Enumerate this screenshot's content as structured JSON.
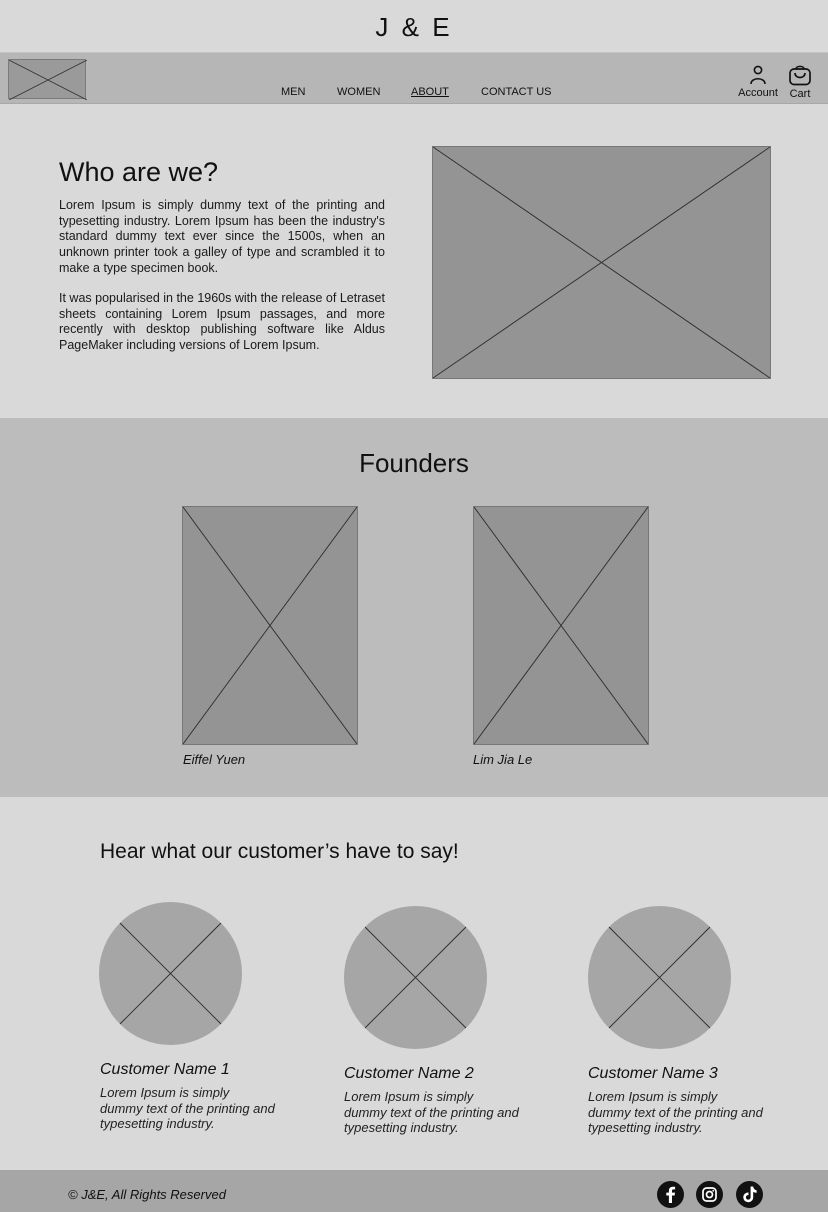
{
  "brand": "J & E",
  "nav": {
    "links": [
      {
        "label": "MEN"
      },
      {
        "label": "WOMEN"
      },
      {
        "label": "ABOUT",
        "active": true
      },
      {
        "label": "CONTACT US"
      }
    ],
    "account_label": "Account",
    "cart_label": "Cart",
    "account_icon": "user-icon",
    "cart_icon": "shopping-bag-icon"
  },
  "about": {
    "title": "Who are we?",
    "paragraph1": "Lorem Ipsum is simply dummy text of the printing and typesetting industry. Lorem Ipsum has been the industry's standard dummy text ever since the 1500s, when an unknown printer took a galley of type and scrambled it to make a type specimen book.",
    "paragraph2": "It was popularised in the 1960s with the release of Letraset sheets containing Lorem Ipsum passages, and more recently with desktop publishing software like Aldus PageMaker including versions of Lorem Ipsum."
  },
  "founders": {
    "title": "Founders",
    "people": [
      {
        "name": "Eiffel Yuen"
      },
      {
        "name": "Lim Jia Le"
      }
    ]
  },
  "testimonials": {
    "title": "Hear what our customer’s have to say!",
    "items": [
      {
        "name": "Customer Name 1",
        "text": "Lorem Ipsum is simply dummy text of the printing and typesetting industry."
      },
      {
        "name": "Customer Name 2",
        "text": "Lorem Ipsum is simply dummy text of the printing and typesetting industry."
      },
      {
        "name": "Customer Name 3",
        "text": "Lorem Ipsum is simply dummy text of the printing and typesetting industry."
      }
    ]
  },
  "footer": {
    "copyright": "© J&E, All Rights Reserved",
    "social_icons": [
      "facebook-icon",
      "instagram-icon",
      "tiktok-icon"
    ]
  },
  "colors": {
    "page_bg": "#d9d9d9",
    "nav_bg": "#b6b6b6",
    "founders_bg": "#bcbcbc",
    "placeholder": "#949494",
    "footer_bg": "#a6a6a6"
  }
}
